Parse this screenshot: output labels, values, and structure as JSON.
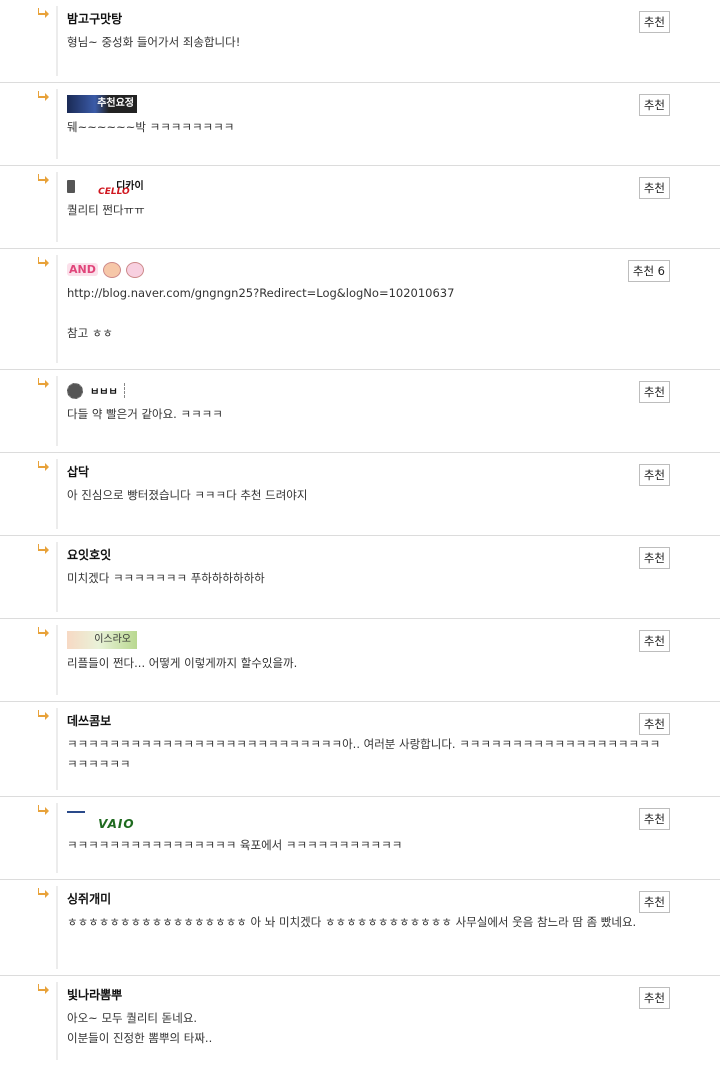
{
  "comments": [
    {
      "nick": "밤고구맛탕",
      "text": "형님~ 중성화 들어가서 죄송합니다!",
      "rec": "추천"
    },
    {
      "nick_img_text": "추천요정",
      "text": "뒈~~~~~~박 ㅋㅋㅋㅋㅋㅋㅋㅋ",
      "rec": "추천"
    },
    {
      "nick_img_text": "디카이",
      "nick_img_sub": "CELLO",
      "text": "퀄리티 쩐다ㅠㅠ",
      "rec": "추천"
    },
    {
      "nick_img_text": "AND",
      "text": "http://blog.naver.com/gngngn25?Redirect=Log&logNo=102010637\n\n참고 ㅎㅎ",
      "rec": "추천 6"
    },
    {
      "nick_img_text": "ㅂㅂㅂ",
      "text": "다들 약 빨은거 같아요. ㅋㅋㅋㅋ",
      "rec": "추천"
    },
    {
      "nick": "삽닥",
      "text": "아 진심으로 빵터졌습니다 ㅋㅋㅋ다 추천 드려야지",
      "rec": "추천"
    },
    {
      "nick": "요잇호잇",
      "text": "미치겠다 ㅋㅋㅋㅋㅋㅋㅋ 푸하하하하하하",
      "rec": "추천"
    },
    {
      "nick_img_text": "이스라오",
      "text": "리플들이 쩐다... 어떻게 이렇게까지 할수있을까.",
      "rec": "추천"
    },
    {
      "nick": "데쓰콤보",
      "text": "ㅋㅋㅋㅋㅋㅋㅋㅋㅋㅋㅋㅋㅋㅋㅋㅋㅋㅋㅋㅋㅋㅋㅋㅋㅋㅋ아.. 여러분 사랑합니다. ㅋㅋㅋㅋㅋㅋㅋㅋㅋㅋㅋㅋㅋㅋㅋㅋㅋㅋㅋㅋㅋㅋㅋㅋㅋ",
      "rec": "추천"
    },
    {
      "nick_img_text": "VAIO",
      "text": "ㅋㅋㅋㅋㅋㅋㅋㅋㅋㅋㅋㅋㅋㅋㅋㅋ 육포에서 ㅋㅋㅋㅋㅋㅋㅋㅋㅋㅋㅋ",
      "rec": "추천"
    },
    {
      "nick": "싱쥐개미",
      "text": "ㅎㅎㅎㅎㅎㅎㅎㅎㅎㅎㅎㅎㅎㅎㅎㅎㅎ 아 놔 미치겠다 ㅎㅎㅎㅎㅎㅎㅎㅎㅎㅎㅎㅎ 사무실에서 웃음 참느라 땀 좀 빴네요.",
      "rec": "추천"
    },
    {
      "nick": "빛나라뽐뿌",
      "text": "아오~ 모두 퀄리티 돋네요.\n이분들이 진정한 뽐뿌의 타짜..",
      "rec": "추천"
    }
  ],
  "colors": {
    "arrow": "#e8a23a",
    "border": "#dcdcdc",
    "button_border": "#bdbdbd"
  }
}
